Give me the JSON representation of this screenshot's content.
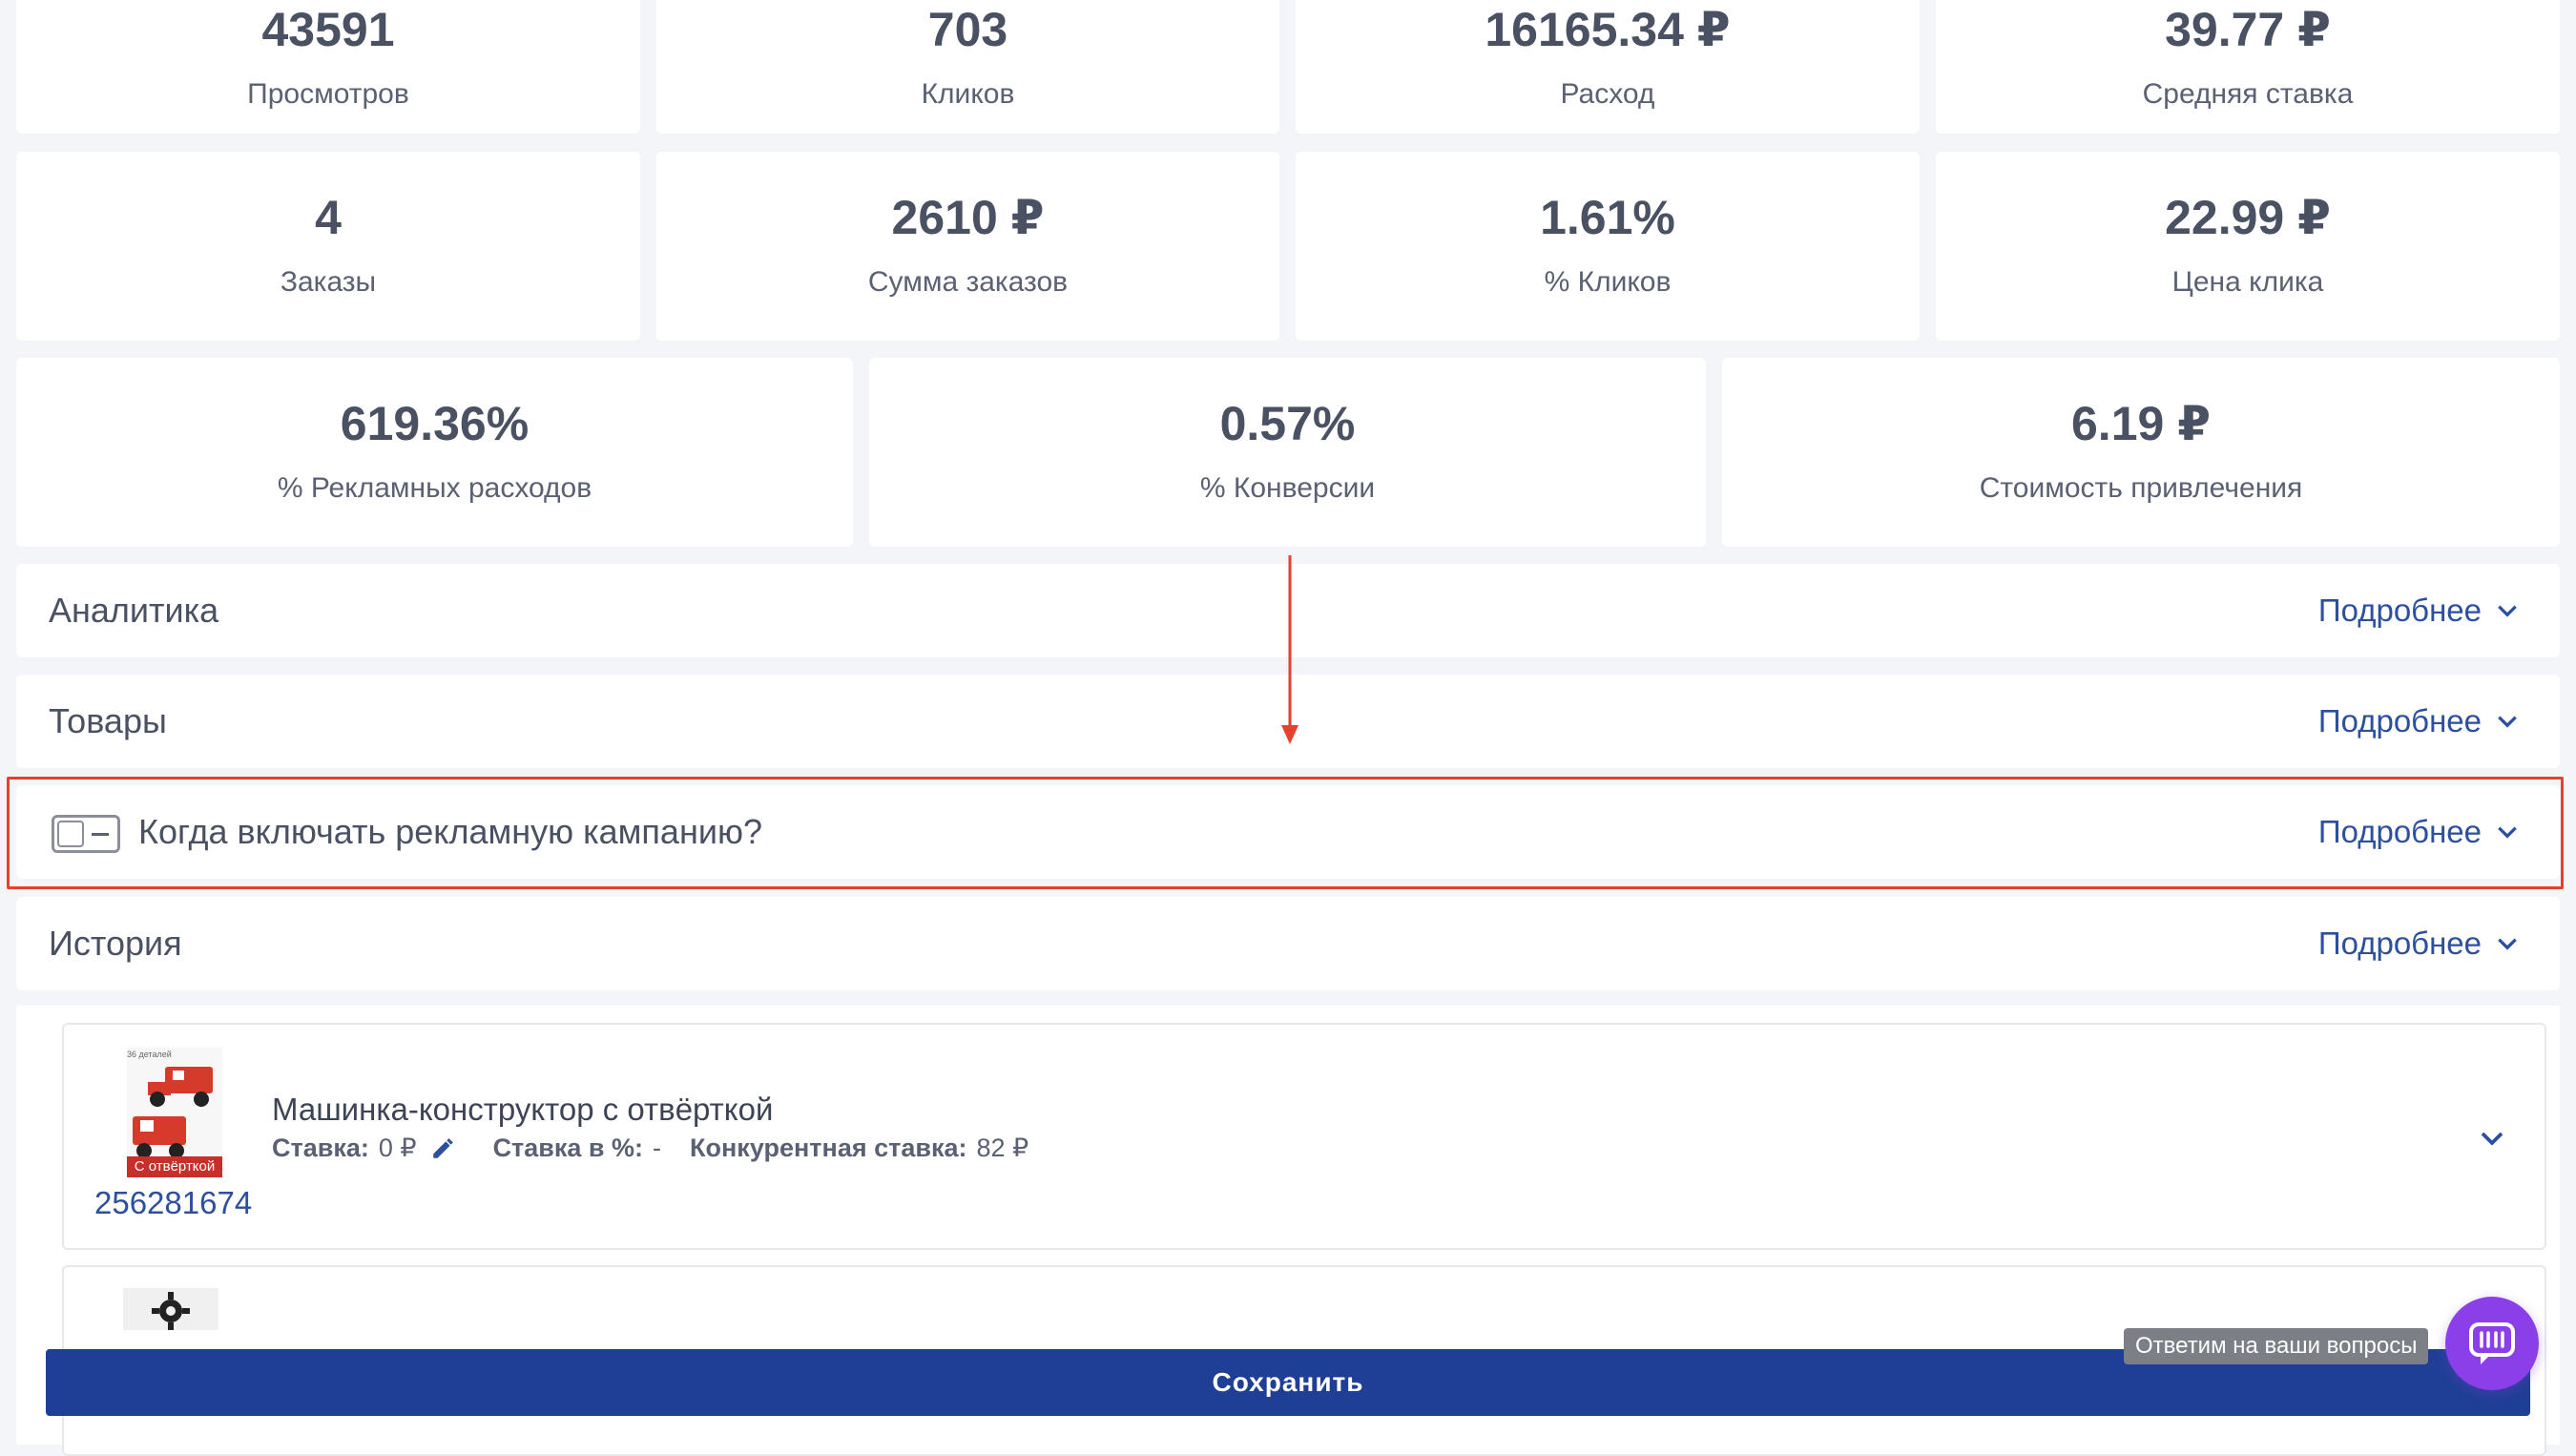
{
  "stats_row1": [
    {
      "value": "43591",
      "label": "Просмотров"
    },
    {
      "value": "703",
      "label": "Кликов"
    },
    {
      "value": "16165.34 ₽",
      "label": "Расход"
    },
    {
      "value": "39.77 ₽",
      "label": "Средняя ставка"
    }
  ],
  "stats_row2": [
    {
      "value": "4",
      "label": "Заказы"
    },
    {
      "value": "2610 ₽",
      "label": "Сумма заказов"
    },
    {
      "value": "1.61%",
      "label": "% Кликов"
    },
    {
      "value": "22.99 ₽",
      "label": "Цена клика"
    }
  ],
  "stats_row3": [
    {
      "value": "619.36%",
      "label": "% Рекламных расходов"
    },
    {
      "value": "0.57%",
      "label": "% Конверсии"
    },
    {
      "value": "6.19 ₽",
      "label": "Стоимость привлечения"
    }
  ],
  "sections": {
    "analytics": {
      "title": "Аналитика",
      "more": "Подробнее"
    },
    "products": {
      "title": "Товары",
      "more": "Подробнее"
    },
    "schedule": {
      "title": "Когда включать рекламную кампанию?",
      "more": "Подробнее"
    },
    "history": {
      "title": "История",
      "more": "Подробнее"
    }
  },
  "product": {
    "name": "Машинка-конструктор с отвёрткой",
    "bid_label": "Ставка:",
    "bid_value": "0 ₽",
    "bid_pct_label": "Ставка в %:",
    "bid_pct_value": "-",
    "competitor_label": "Конкурентная ставка:",
    "competitor_value": "82 ₽",
    "sku": "256281674",
    "thumb_badge": "С отвёрткой",
    "thumb_top": "36 деталей"
  },
  "save_label": "Сохранить",
  "chat_tooltip": "Ответим на ваши вопросы",
  "colors": {
    "accent": "#2c4f9e",
    "button": "#1f3f96",
    "highlight": "#e4422e",
    "chat": "#8b3fe8"
  }
}
